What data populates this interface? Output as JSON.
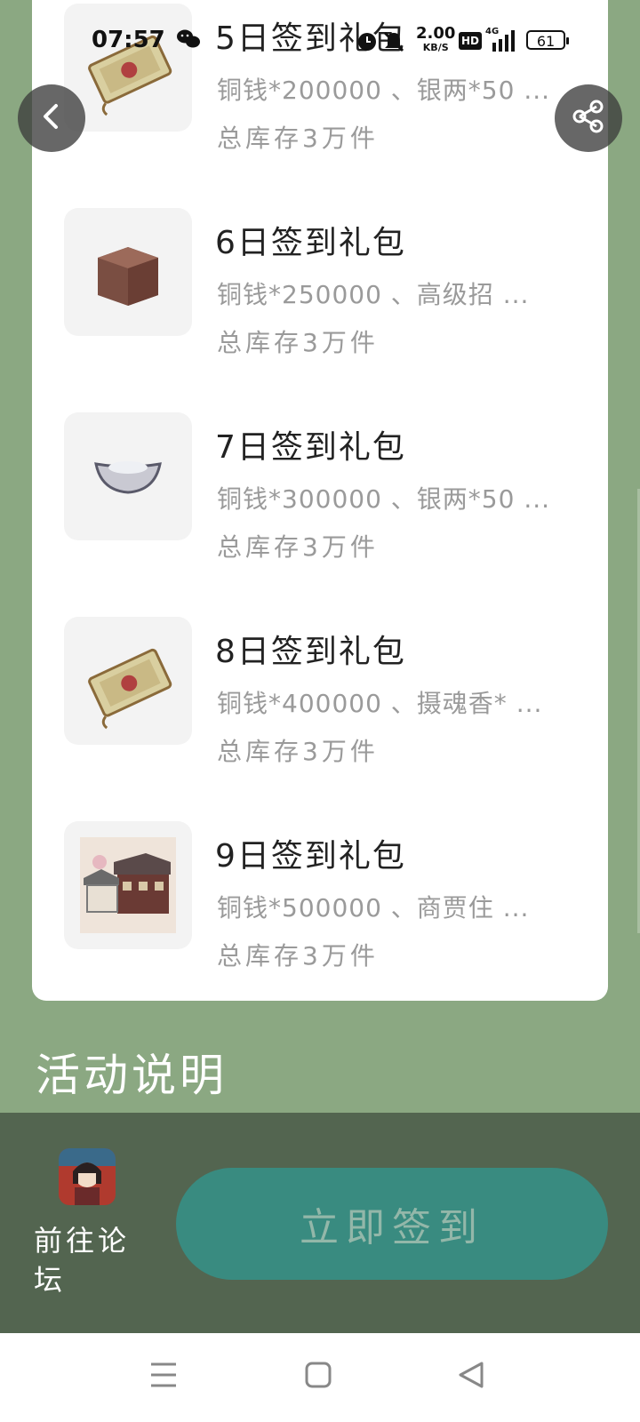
{
  "status_bar": {
    "time": "07:57",
    "net_speed_value": "2.00",
    "net_speed_unit": "KB/S",
    "hd_badge": "HD",
    "network": "4G",
    "battery": "61"
  },
  "gift_packs": [
    {
      "title": "5日签到礼包",
      "desc": "铜钱*200000 、银两*50 ...",
      "stock": "总库存3万件",
      "icon": "scroll-icon"
    },
    {
      "title": "6日签到礼包",
      "desc": "铜钱*250000 、高级招 ...",
      "stock": "总库存3万件",
      "icon": "box-icon"
    },
    {
      "title": "7日签到礼包",
      "desc": "铜钱*300000 、银两*50 ...",
      "stock": "总库存3万件",
      "icon": "silver-ingot-icon"
    },
    {
      "title": "8日签到礼包",
      "desc": "铜钱*400000 、摄魂香* ...",
      "stock": "总库存3万件",
      "icon": "scroll-icon"
    },
    {
      "title": "9日签到礼包",
      "desc": "铜钱*500000 、商贾住 ...",
      "stock": "总库存3万件",
      "icon": "building-icon"
    }
  ],
  "section": {
    "title": "活动说明"
  },
  "bottom_bar": {
    "forum_label": "前往论坛",
    "signin_button": "立即签到"
  },
  "colors": {
    "page_background": "#8ba882",
    "bottom_bar": "#536550",
    "signin_button": "#398b80"
  }
}
